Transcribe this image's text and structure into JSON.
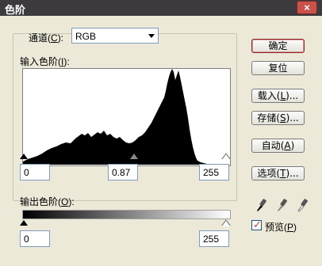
{
  "window": {
    "title": "色阶",
    "close_label": "×"
  },
  "channel": {
    "label": "通道",
    "hotkey": "C",
    "selected": "RGB"
  },
  "input_levels": {
    "label": "输入色阶",
    "hotkey": "I",
    "black": "0",
    "gamma": "0.87",
    "white": "255"
  },
  "output_levels": {
    "label": "输出色阶",
    "hotkey": "O",
    "black": "0",
    "white": "255"
  },
  "buttons": {
    "ok": "确定",
    "reset": "复位",
    "load": "载入",
    "load_hotkey": "L",
    "save": "存储",
    "save_hotkey": "S",
    "auto": "自动",
    "auto_hotkey": "A",
    "options": "选项",
    "options_hotkey": "T"
  },
  "preview": {
    "label": "预览",
    "hotkey": "P",
    "checked": true
  },
  "eyedroppers": [
    "black-point-eyedropper-icon",
    "gray-point-eyedropper-icon",
    "white-point-eyedropper-icon"
  ]
}
